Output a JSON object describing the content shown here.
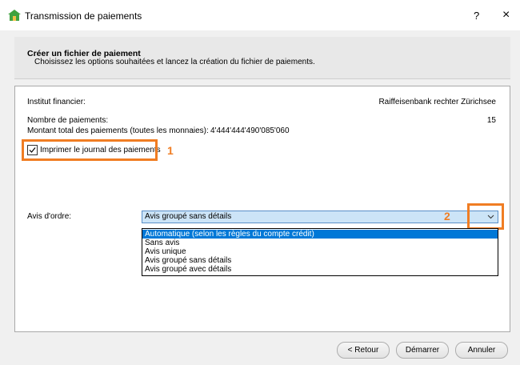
{
  "window": {
    "title": "Transmission de paiements",
    "help_glyph": "?",
    "close_glyph": "×"
  },
  "header": {
    "title": "Créer un fichier de paiement",
    "subtitle": "Choisissez les options souhaitées et lancez la création du fichier de paiements."
  },
  "info": {
    "institution_label": "Institut financier:",
    "institution_value": "Raiffeisenbank rechter Zürichsee",
    "count_label": "Nombre de paiements:",
    "count_value": "15",
    "total_label": "Montant total des paiements (toutes les monnaies):",
    "total_value": "4'444'444'490'085'060"
  },
  "checkbox": {
    "label": "Imprimer le journal des paiements",
    "checked": true
  },
  "callouts": {
    "one": "1",
    "two": "2",
    "color": "#f07d23"
  },
  "avis": {
    "label": "Avis d'ordre:",
    "selected": "Avis groupé sans détails",
    "options": [
      "Automatique (selon les règles du compte crédit)",
      "Sans avis",
      "Avis unique",
      "Avis groupé sans détails",
      "Avis groupé avec détails"
    ]
  },
  "buttons": {
    "back": "< Retour",
    "start": "Démarrer",
    "cancel": "Annuler"
  }
}
